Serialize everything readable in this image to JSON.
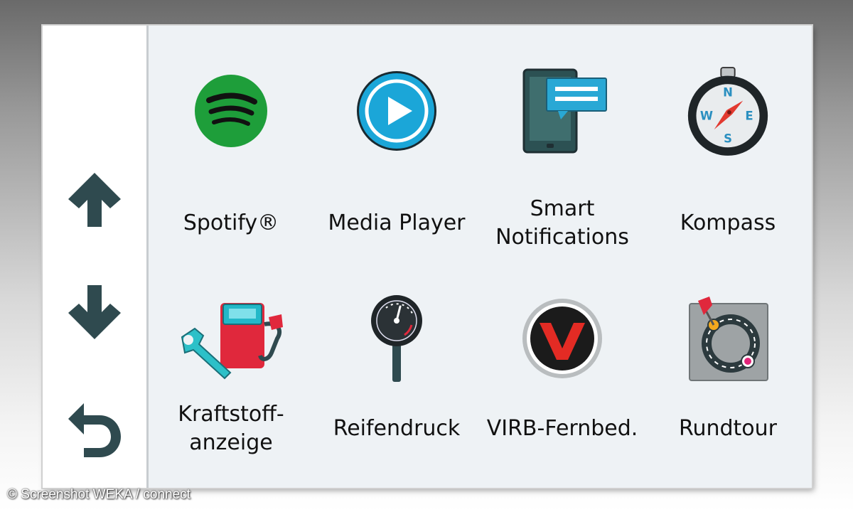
{
  "apps": [
    {
      "label": "Spotify®",
      "icon": "spotify-icon"
    },
    {
      "label": "Media Player",
      "icon": "play-icon"
    },
    {
      "label": "Smart\nNotifications",
      "icon": "notifications-icon"
    },
    {
      "label": "Kompass",
      "icon": "compass-icon"
    },
    {
      "label": "Kraftstoff-\nanzeige",
      "icon": "fuel-gauge-icon"
    },
    {
      "label": "Reifendruck",
      "icon": "tire-pressure-icon"
    },
    {
      "label": "VIRB-Fernbed.",
      "icon": "virb-icon"
    },
    {
      "label": "Rundtour",
      "icon": "round-trip-icon"
    }
  ],
  "compass_letters": {
    "n": "N",
    "e": "E",
    "s": "S",
    "w": "W"
  },
  "nav": {
    "up": "arrow-up-icon",
    "down": "arrow-down-icon",
    "back": "back-icon"
  },
  "credit": "© Screenshot WEKA / connect",
  "colors": {
    "spotify_green": "#1e9e3a",
    "media_blue": "#1ba6d8",
    "notification_blue": "#29a8d5",
    "nav_arrow": "#2f4a4f",
    "virb_red": "#e32b24"
  }
}
